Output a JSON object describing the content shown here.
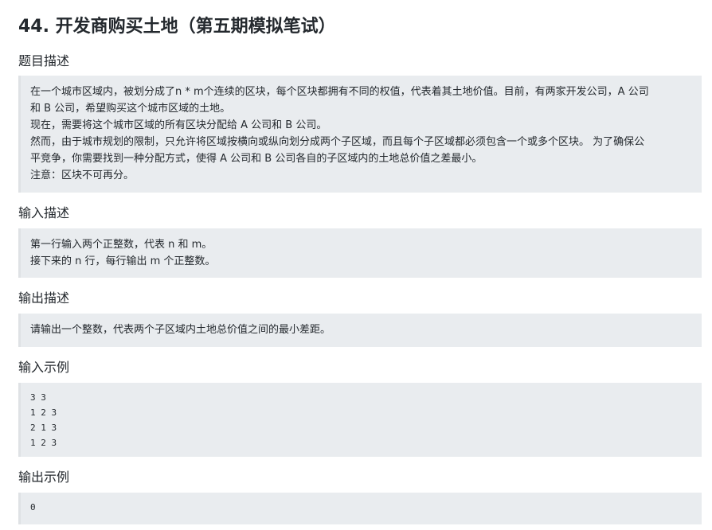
{
  "title": "44. 开发商购买土地（第五期模拟笔试）",
  "sections": [
    {
      "heading": "题目描述",
      "lines": [
        "在一个城市区域内，被划分成了n * m个连续的区块，每个区块都拥有不同的权值，代表着其土地价值。目前，有两家开发公司，A 公司",
        "和 B 公司，希望购买这个城市区域的土地。",
        "现在，需要将这个城市区域的所有区块分配给 A 公司和 B 公司。",
        "然而，由于城市规划的限制，只允许将区域按横向或纵向划分成两个子区域，而且每个子区域都必须包含一个或多个区块。 为了确保公",
        "平竞争，你需要找到一种分配方式，使得 A 公司和 B 公司各自的子区域内的土地总价值之差最小。",
        "注意：区块不可再分。"
      ]
    },
    {
      "heading": "输入描述",
      "lines": [
        "第一行输入两个正整数，代表 n 和 m。",
        "接下来的 n 行，每行输出 m 个正整数。"
      ]
    },
    {
      "heading": "输出描述",
      "lines": [
        "请输出一个整数，代表两个子区域内土地总价值之间的最小差距。"
      ]
    },
    {
      "heading": "输入示例",
      "code_lines": [
        "3 3",
        "1 2 3",
        "2 1 3",
        "1 2 3"
      ]
    },
    {
      "heading": "输出示例",
      "code_lines": [
        "0"
      ]
    }
  ]
}
